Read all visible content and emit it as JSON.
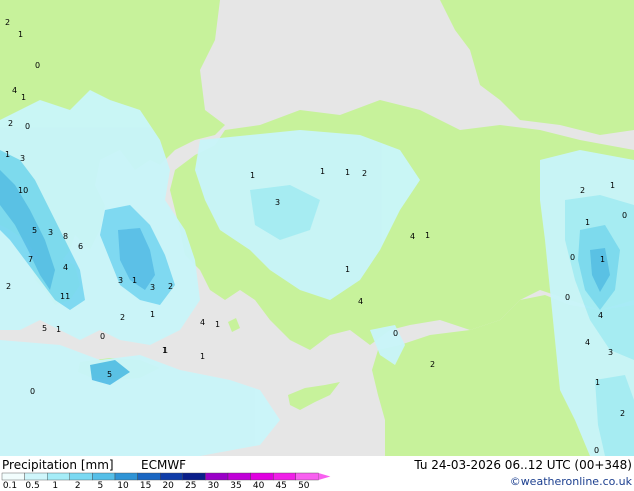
{
  "map": {
    "land_color": "#c7f29b",
    "sea_color": "#e6e6e6",
    "precip_colors": [
      "#c9f5fa",
      "#a5ecf7",
      "#7ad9f2",
      "#55bfe8",
      "#2f94d6"
    ],
    "station_values": [
      "2",
      "1",
      "0",
      "4",
      "1",
      "2",
      "0",
      "1",
      "3",
      "10",
      "5",
      "3",
      "7",
      "8",
      "4",
      "6",
      "11",
      "2",
      "5",
      "1",
      "3",
      "1",
      "3",
      "2",
      "4",
      "1",
      "2",
      "1",
      "0",
      "1",
      "1",
      "1",
      "3",
      "1",
      "1",
      "2",
      "4",
      "1",
      "1",
      "4",
      "0",
      "2",
      "2",
      "1",
      "1",
      "0",
      "0",
      "1",
      "0",
      "4",
      "4",
      "3",
      "1",
      "2",
      "0",
      "5",
      "1",
      "0"
    ]
  },
  "footer": {
    "title": "Precipitation [mm]",
    "model": "ECMWF",
    "datetime": "Tu 24-03-2026 06..12 UTC (00+348)",
    "credit": "©weatheronline.co.uk",
    "scale_labels": [
      "0.1",
      "0.5",
      "1",
      "2",
      "5",
      "10",
      "15",
      "20",
      "25",
      "30",
      "35",
      "40",
      "45",
      "50"
    ],
    "scale_colors": [
      "#f2fdfd",
      "#cff6fb",
      "#a5ecf7",
      "#7ad9f2",
      "#55bfe8",
      "#2f94d6",
      "#1a66c2",
      "#0f3ca8",
      "#0a1f8a",
      "#9a00c8",
      "#c000d8",
      "#e000e0",
      "#f020e8",
      "#f860f0"
    ]
  }
}
